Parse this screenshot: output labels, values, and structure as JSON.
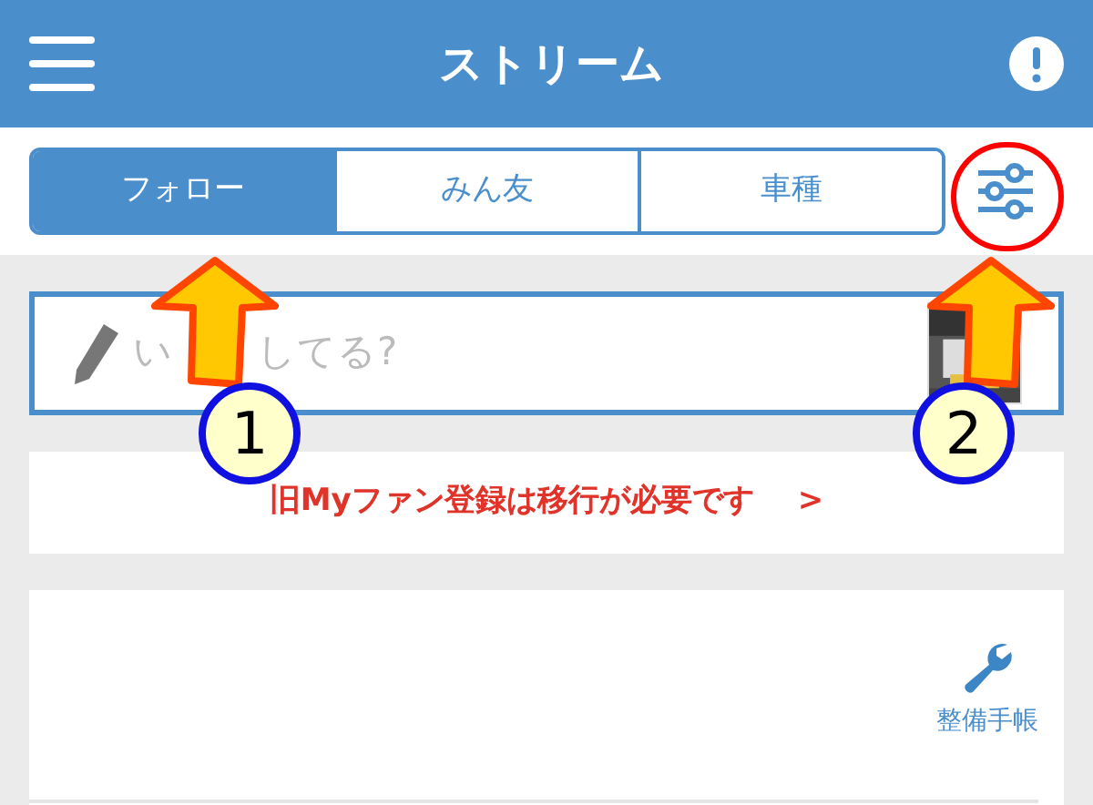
{
  "header": {
    "title": "ストリーム"
  },
  "tabs": [
    {
      "label": "フォロー",
      "selected": true
    },
    {
      "label": "みん友",
      "selected": false
    },
    {
      "label": "車種",
      "selected": false
    }
  ],
  "post_field": {
    "placeholder_parts": [
      "い",
      "してる?"
    ]
  },
  "notice": {
    "text": "旧Myファン登録は移行が必要です",
    "arrow": ">"
  },
  "shortcut": {
    "label": "整備手帳"
  },
  "annotations": [
    {
      "number": "1"
    },
    {
      "number": "2"
    }
  ]
}
